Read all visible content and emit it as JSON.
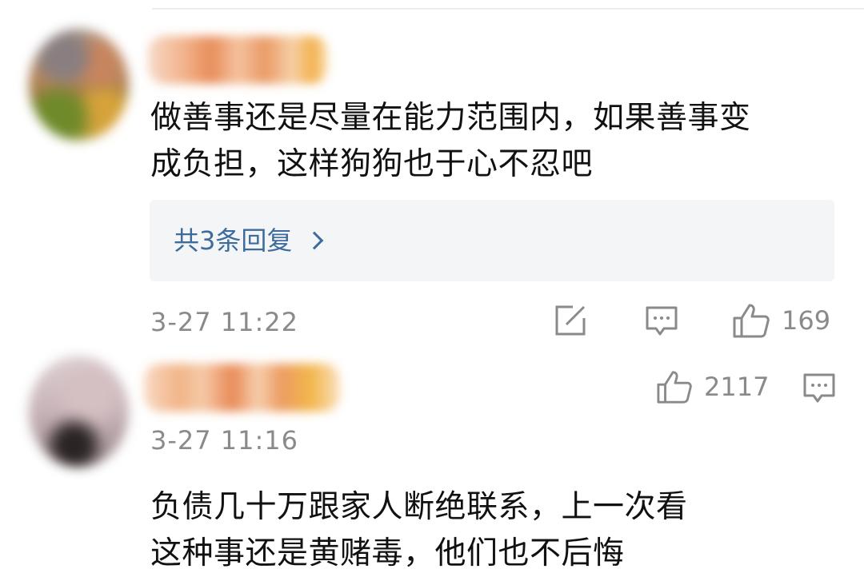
{
  "comments": [
    {
      "text_line1": "做善事还是尽量在能力范围内，如果善事变",
      "text_line2": "成负担，这样狗狗也于心不忍吧",
      "replies_label": "共3条回复",
      "timestamp": "3-27 11:22",
      "likes": "169"
    },
    {
      "likes": "2117",
      "timestamp": "3-27 11:16",
      "text_line1": "负债几十万跟家人断绝联系，上一次看",
      "text_line2": "这种事还是黄赌毒，他们也不后悔"
    }
  ],
  "icons": {
    "share": "share-icon",
    "comment": "comment-icon",
    "like": "thumbs-up-icon",
    "chevron": "chevron-right-icon"
  },
  "colors": {
    "link": "#3d6c9c",
    "meta": "#8a8a8a",
    "reply_bg": "#f4f5f7"
  }
}
